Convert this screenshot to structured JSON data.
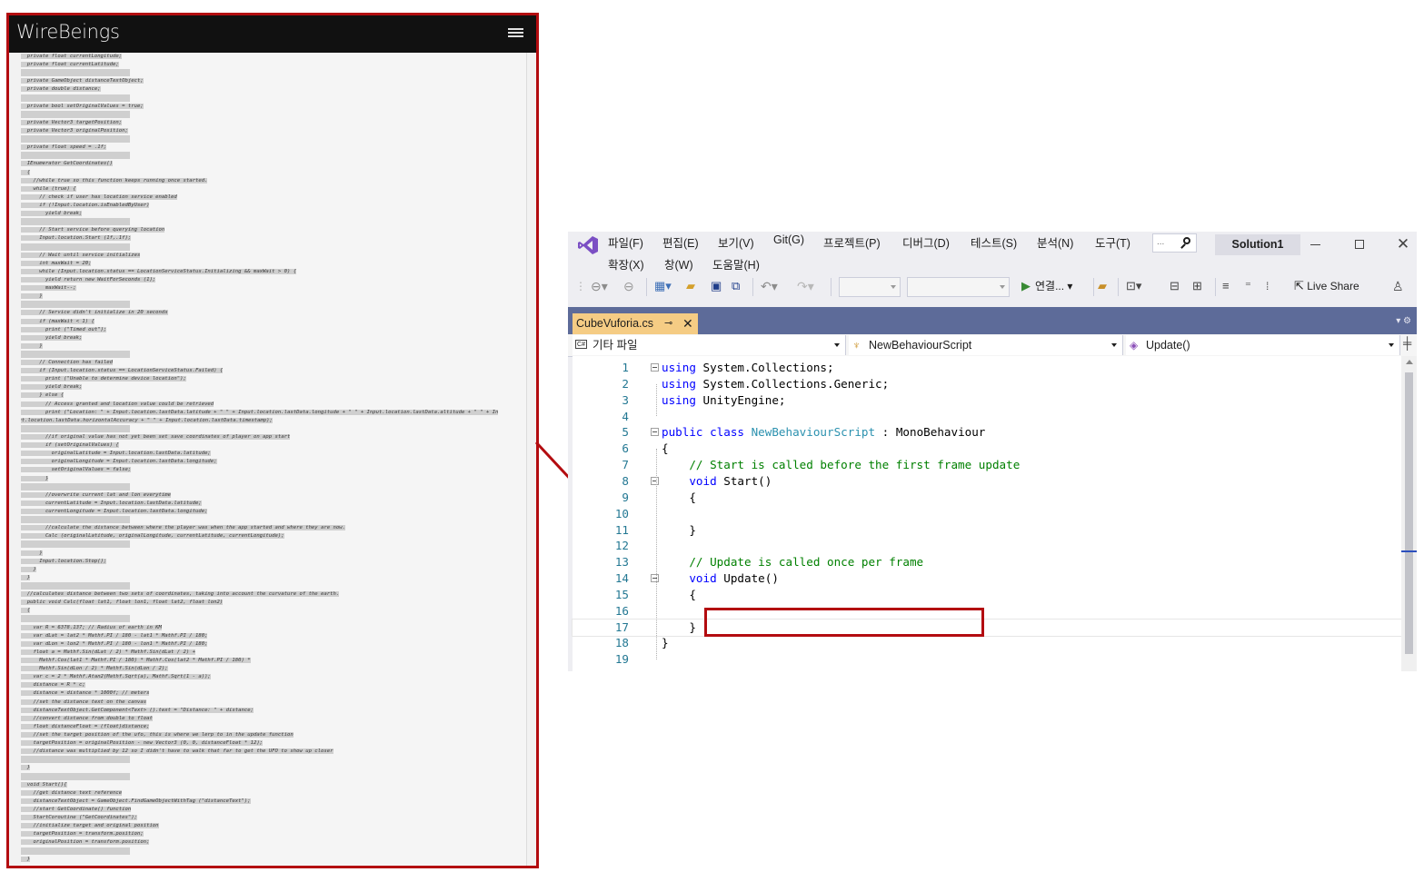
{
  "web": {
    "site_title": "WireBeings",
    "menu_icon": "hamburger-menu-icon",
    "code_lines": [
      "  private float currentLongitude;",
      "  private float currentLatitude;",
      "",
      "  private GameObject distanceTextObject;",
      "  private double distance;",
      "",
      "  private bool setOriginalValues = true;",
      "",
      "  private Vector3 targetPosition;",
      "  private Vector3 originalPosition;",
      "",
      "  private float speed = .1f;",
      "",
      "  IEnumerator GetCoordinates()",
      "  {",
      "    //while true so this function keeps running once started.",
      "    while (true) {",
      "      // check if user has location service enabled",
      "      if (!Input.location.isEnabledByUser)",
      "        yield break;",
      "",
      "      // Start service before querying location",
      "      Input.location.Start (1f,.1f);",
      "",
      "      // Wait until service initializes",
      "      int maxWait = 20;",
      "      while (Input.location.status == LocationServiceStatus.Initializing && maxWait > 0) {",
      "        yield return new WaitForSeconds (1);",
      "        maxWait--;",
      "      }",
      "",
      "      // Service didn't initialize in 20 seconds",
      "      if (maxWait < 1) {",
      "        print (\"Timed out\");",
      "        yield break;",
      "      }",
      "",
      "      // Connection has failed",
      "      if (Input.location.status == LocationServiceStatus.Failed) {",
      "        print (\"Unable to determine device location\");",
      "        yield break;",
      "      } else {",
      "        // Access granted and location value could be retrieved",
      "        print (\"Location: \" + Input.location.lastData.latitude + \" \" + Input.location.lastData.longitude + \" \" + Input.location.lastData.altitude + \" \" + In",
      "put.location.lastData.horizontalAccuracy + \" \" + Input.location.lastData.timestamp);",
      "",
      "        //if original value has not yet been set save coordinates of player on app start",
      "        if (setOriginalValues) {",
      "          originalLatitude = Input.location.lastData.latitude;",
      "          originalLongitude = Input.location.lastData.longitude;",
      "          setOriginalValues = false;",
      "        }",
      "",
      "        //overwrite current lat and lon everytime",
      "        currentLatitude = Input.location.lastData.latitude;",
      "        currentLongitude = Input.location.lastData.longitude;",
      "",
      "        //calculate the distance between where the player was when the app started and where they are now.",
      "        Calc (originalLatitude, originalLongitude, currentLatitude, currentLongitude);",
      "",
      "      }",
      "      Input.location.Stop();",
      "    }",
      "  }",
      "",
      "  //calculates distance between two sets of coordinates, taking into account the curvature of the earth.",
      "  public void Calc(float lat1, float lon1, float lat2, float lon2)",
      "  {",
      "",
      "    var R = 6378.137; // Radius of earth in KM",
      "    var dLat = lat2 * Mathf.PI / 180 - lat1 * Mathf.PI / 180;",
      "    var dLon = lon2 * Mathf.PI / 180 - lon1 * Mathf.PI / 180;",
      "    float a = Mathf.Sin(dLat / 2) * Mathf.Sin(dLat / 2) +",
      "      Mathf.Cos(lat1 * Mathf.PI / 180) * Mathf.Cos(lat2 * Mathf.PI / 180) *",
      "      Mathf.Sin(dLon / 2) * Mathf.Sin(dLon / 2);",
      "    var c = 2 * Mathf.Atan2(Mathf.Sqrt(a), Mathf.Sqrt(1 - a));",
      "    distance = R * c;",
      "    distance = distance * 1000f; // meters",
      "    //set the distance text on the canvas",
      "    distanceTextObject.GetComponent<Text> ().text = \"Distance: \" + distance;",
      "    //convert distance from double to float",
      "    float distanceFloat = (float)distance;",
      "    //set the target position of the ufo, this is where we lerp to in the update function",
      "    targetPosition = originalPosition - new Vector3 (0, 0, distanceFloat * 12);",
      "    //distance was multiplied by 12 so I didn't have to walk that far to get the UFO to show up closer",
      "",
      "  }",
      "",
      "  void Start(){",
      "    //get distance text reference",
      "    distanceTextObject = GameObject.FindGameObjectWithTag (\"distanceText\");",
      "    //start GetCoordinate() function",
      "    StartCoroutine (\"GetCoordinates\");",
      "    //initialize target and original position",
      "    targetPosition = transform.position;",
      "    originalPosition = transform.position;",
      "",
      "  }"
    ]
  },
  "vs": {
    "logo_icon": "visual-studio-logo-icon",
    "menu": [
      "파일(F)",
      "편집(E)",
      "보기(V)",
      "Git(G)",
      "프로젝트(P)",
      "디버그(D)",
      "테스트(S)",
      "분석(N)",
      "도구(T)",
      "확장(X)",
      "창(W)",
      "도움말(H)"
    ],
    "search_placeholder": "...",
    "solution_name": "Solution1",
    "toolbar": {
      "connect_label": "연결...",
      "live_share_label": "Live Share"
    },
    "tab": {
      "filename": "CubeVuforia.cs",
      "pin_glyph": "⊸",
      "close_glyph": "✕"
    },
    "navbar": {
      "project": "기타 파일",
      "class": "NewBehaviourScript",
      "member": "Update()"
    },
    "code": [
      {
        "n": "1",
        "fold": true,
        "parts": [
          [
            "kw",
            "using"
          ],
          [
            "t",
            " System.Collections;"
          ]
        ]
      },
      {
        "n": "2",
        "fold": false,
        "parts": [
          [
            "kw",
            "using"
          ],
          [
            "t",
            " System.Collections.Generic;"
          ]
        ]
      },
      {
        "n": "3",
        "fold": false,
        "parts": [
          [
            "kw",
            "using"
          ],
          [
            "t",
            " UnityEngine;"
          ]
        ]
      },
      {
        "n": "4",
        "fold": false,
        "parts": []
      },
      {
        "n": "5",
        "fold": true,
        "parts": [
          [
            "kw",
            "public class"
          ],
          [
            "t",
            " "
          ],
          [
            "ty",
            "NewBehaviourScript"
          ],
          [
            "t",
            " : MonoBehaviour"
          ]
        ]
      },
      {
        "n": "6",
        "fold": false,
        "parts": [
          [
            "t",
            "{"
          ]
        ]
      },
      {
        "n": "7",
        "fold": false,
        "parts": [
          [
            "t",
            "    "
          ],
          [
            "cm",
            "// Start is called before the first frame update"
          ]
        ]
      },
      {
        "n": "8",
        "fold": true,
        "parts": [
          [
            "t",
            "    "
          ],
          [
            "kw",
            "void"
          ],
          [
            "t",
            " Start()"
          ]
        ]
      },
      {
        "n": "9",
        "fold": false,
        "parts": [
          [
            "t",
            "    {"
          ]
        ]
      },
      {
        "n": "10",
        "fold": false,
        "parts": []
      },
      {
        "n": "11",
        "fold": false,
        "parts": [
          [
            "t",
            "    }"
          ]
        ]
      },
      {
        "n": "12",
        "fold": false,
        "parts": []
      },
      {
        "n": "13",
        "fold": false,
        "parts": [
          [
            "t",
            "    "
          ],
          [
            "cm",
            "// Update is called once per frame"
          ]
        ]
      },
      {
        "n": "14",
        "fold": true,
        "parts": [
          [
            "t",
            "    "
          ],
          [
            "kw",
            "void"
          ],
          [
            "t",
            " Update()"
          ]
        ]
      },
      {
        "n": "15",
        "fold": false,
        "parts": [
          [
            "t",
            "    {"
          ]
        ]
      },
      {
        "n": "16",
        "fold": false,
        "parts": []
      },
      {
        "n": "17",
        "fold": false,
        "parts": [
          [
            "t",
            "    }"
          ]
        ]
      },
      {
        "n": "18",
        "fold": false,
        "parts": [
          [
            "t",
            "}"
          ]
        ]
      },
      {
        "n": "19",
        "fold": false,
        "parts": []
      }
    ]
  },
  "colors": {
    "callout": "#b30c10",
    "keyword": "#0000ff",
    "type": "#2b91af",
    "comment": "#008000",
    "line_number": "#237893",
    "doc_tab": "#f5cc84",
    "doc_well": "#5d6b99"
  }
}
